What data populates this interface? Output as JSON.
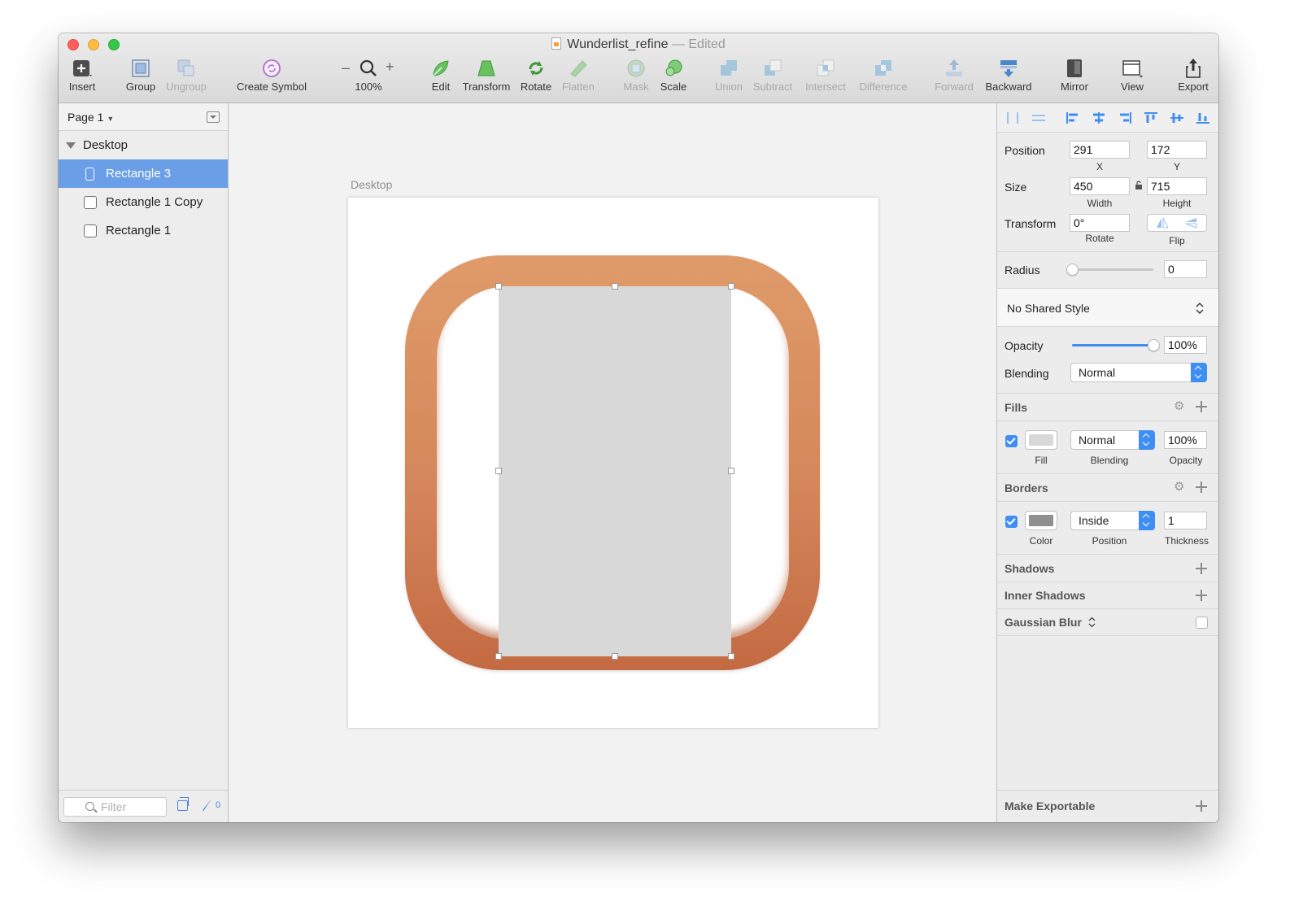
{
  "window": {
    "title": "Wunderlist_refine",
    "separator": "—",
    "edited": "Edited"
  },
  "toolbar": {
    "insert": "Insert",
    "group": "Group",
    "ungroup": "Ungroup",
    "create_symbol": "Create Symbol",
    "zoom_minus": "–",
    "zoom_plus": "+",
    "zoom": "100%",
    "edit": "Edit",
    "transform": "Transform",
    "rotate": "Rotate",
    "flatten": "Flatten",
    "mask": "Mask",
    "scale": "Scale",
    "union": "Union",
    "subtract": "Subtract",
    "intersect": "Intersect",
    "difference": "Difference",
    "forward": "Forward",
    "backward": "Backward",
    "mirror": "Mirror",
    "view": "View",
    "export": "Export"
  },
  "sidebar": {
    "page": "Page 1",
    "layers": [
      {
        "name": "Desktop",
        "type": "artboard"
      },
      {
        "name": "Rectangle 3",
        "type": "shape",
        "selected": true
      },
      {
        "name": "Rectangle 1 Copy",
        "type": "shape"
      },
      {
        "name": "Rectangle 1",
        "type": "shape"
      }
    ],
    "filter_placeholder": "Filter",
    "slice_count": "0"
  },
  "canvas": {
    "artboard_label": "Desktop",
    "icon_color_top": "#e09b6a",
    "icon_color_bottom": "#c46a42",
    "selected_fill": "#d8d8d8"
  },
  "inspector": {
    "position": {
      "label": "Position",
      "x": "291",
      "y": "172",
      "x_label": "X",
      "y_label": "Y"
    },
    "size": {
      "label": "Size",
      "width": "450",
      "height": "715",
      "width_label": "Width",
      "height_label": "Height"
    },
    "transform": {
      "label": "Transform",
      "rotate": "0°",
      "rotate_label": "Rotate",
      "flip_label": "Flip"
    },
    "radius": {
      "label": "Radius",
      "value": "0",
      "slider_level": 0
    },
    "shared_style": "No Shared Style",
    "opacity": {
      "label": "Opacity",
      "value": "100%",
      "slider_level": 1.0
    },
    "blending": {
      "label": "Blending",
      "value": "Normal"
    },
    "fills": {
      "title": "Fills",
      "enabled": true,
      "color": "#d8d8d8",
      "blending": "Normal",
      "opacity": "100%",
      "fill_label": "Fill",
      "blending_label": "Blending",
      "opacity_label": "Opacity"
    },
    "borders": {
      "title": "Borders",
      "enabled": true,
      "color": "#8f8f8f",
      "position": "Inside",
      "thickness": "1",
      "color_label": "Color",
      "position_label": "Position",
      "thickness_label": "Thickness"
    },
    "shadows": "Shadows",
    "inner_shadows": "Inner Shadows",
    "gaussian_blur": "Gaussian Blur",
    "make_exportable": "Make Exportable"
  },
  "accent_color": "#3f8ef3",
  "selection_color": "#6a9ee6"
}
